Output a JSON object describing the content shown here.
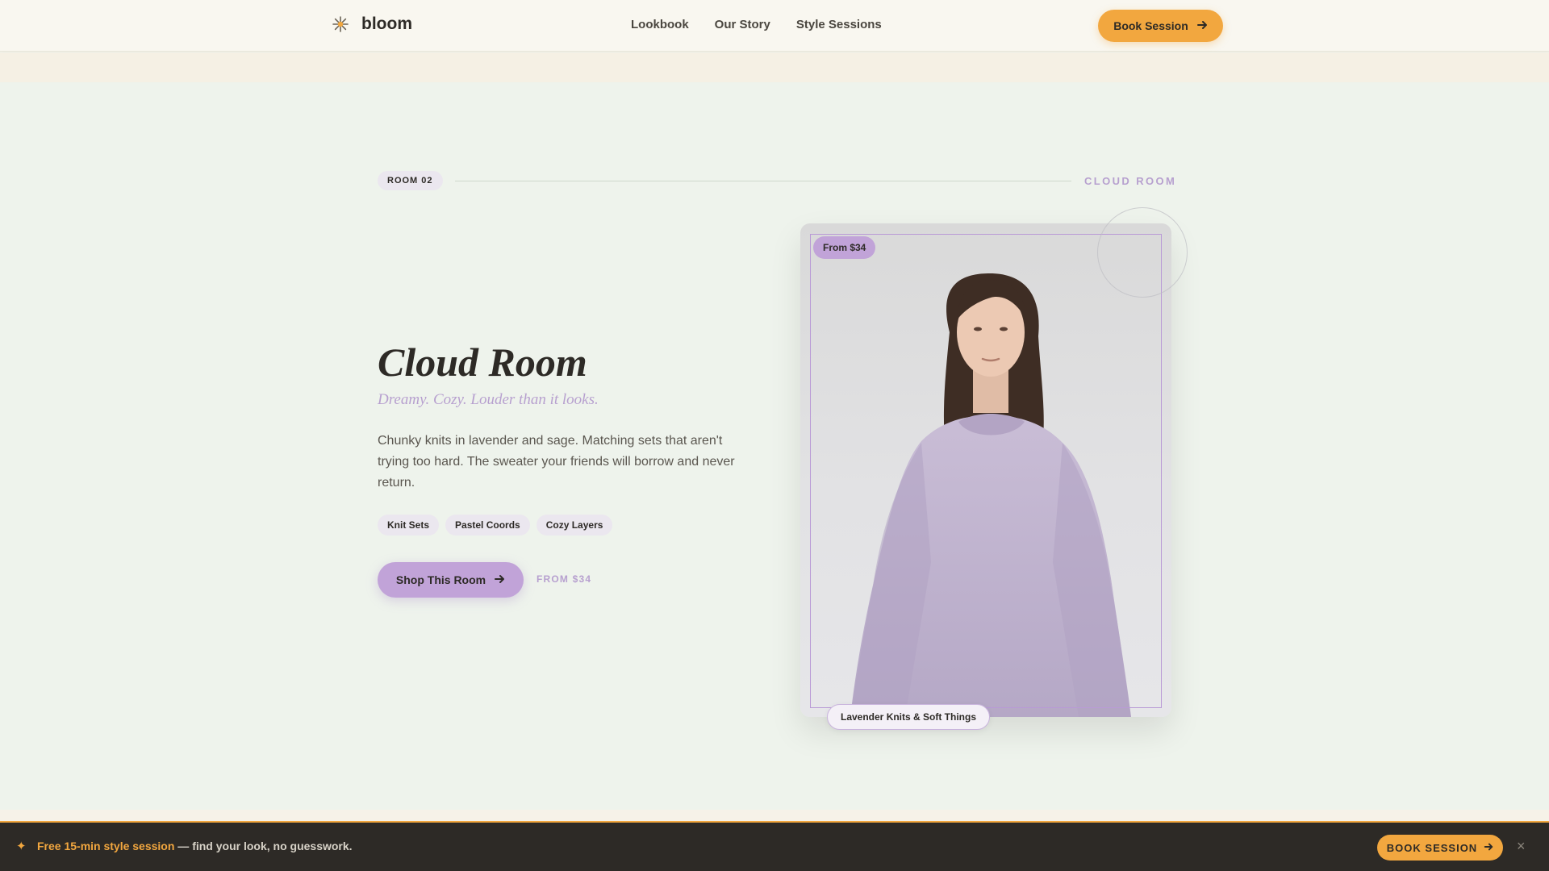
{
  "nav": {
    "brand": "bloom",
    "links": [
      "Lookbook",
      "Our Story",
      "Style Sessions"
    ],
    "book_label": "Book Session"
  },
  "room": {
    "tag": "ROOM 02",
    "name_right": "CLOUD ROOM",
    "title": "Cloud Room",
    "subtitle": "Dreamy. Cozy. Louder than it looks.",
    "description": "Chunky knits in lavender and sage. Matching sets that aren't trying too hard. The sweater your friends will borrow and never return.",
    "tags": [
      "Knit Sets",
      "Pastel Coords",
      "Cozy Layers"
    ],
    "shop_label": "Shop This Room",
    "from_label": "FROM $34",
    "price_badge": "From $34",
    "image_caption": "Lavender Knits & Soft Things"
  },
  "banner": {
    "highlight": "Free 15-min style session",
    "text": " — find your look, no guesswork.",
    "button_label": "BOOK SESSION",
    "close_label": "×"
  },
  "colors": {
    "accent_orange": "#f2a73f",
    "accent_lavender": "#c1a3d8",
    "page_bg": "#eef3ec",
    "nav_bg": "#f9f7f0",
    "banner_bg": "#2d2a26"
  },
  "icons": {
    "logo": "sparkle-flower-icon",
    "arrow": "arrow-right-icon",
    "close": "close-icon",
    "star": "sparkle-star-icon"
  }
}
